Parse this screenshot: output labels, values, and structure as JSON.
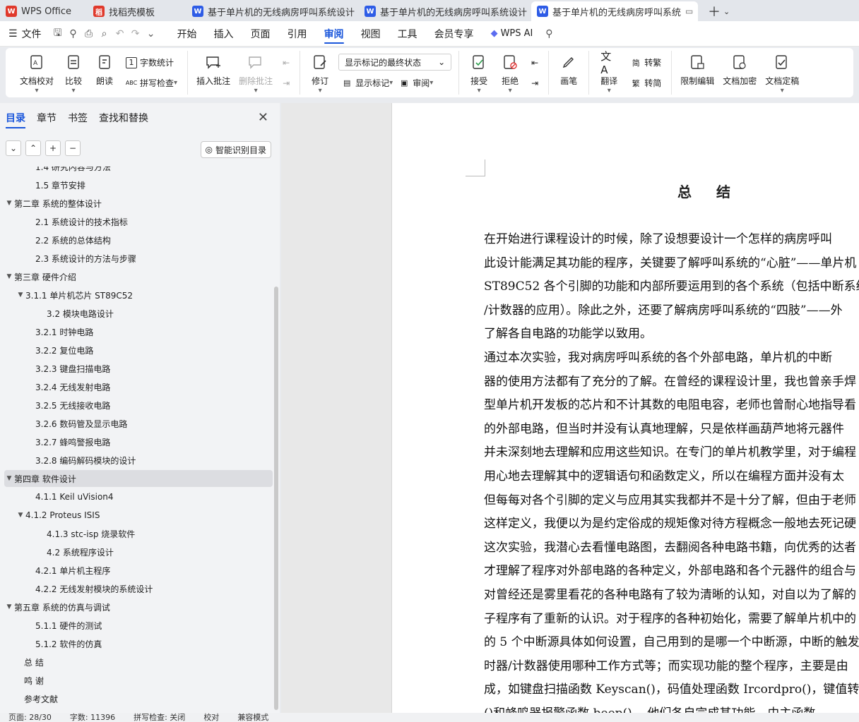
{
  "tabs": [
    {
      "label": "WPS Office",
      "icon": "wps-logo-icon",
      "color": "#e0392b"
    },
    {
      "label": "找稻壳模板",
      "icon": "docer-logo-icon",
      "color": "#e0392b"
    },
    {
      "label": "基于单片机的无线病房呼叫系统设计",
      "icon": "writer-doc-icon",
      "color": "#2e5ce6"
    },
    {
      "label": "基于单片机的无线病房呼叫系统设计",
      "icon": "writer-doc-icon",
      "color": "#2e5ce6"
    },
    {
      "label": "基于单片机的无线病房呼叫系统",
      "icon": "writer-doc-icon",
      "color": "#2e5ce6",
      "active": true
    }
  ],
  "menubar": {
    "file_label": "文件",
    "items": [
      "开始",
      "插入",
      "页面",
      "引用",
      "审阅",
      "视图",
      "工具",
      "会员专享"
    ],
    "active": "审阅",
    "ai_label": "WPS AI"
  },
  "ribbon": {
    "doc_proof": "文档校对",
    "compare": "比较",
    "read_aloud": "朗读",
    "word_count": "字数统计",
    "spell_check": "拼写检查",
    "insert_comment": "插入批注",
    "delete_comment": "删除批注",
    "track_changes": "修订",
    "markup_state": "显示标记的最终状态",
    "show_markup": "显示标记",
    "review": "审阅",
    "accept": "接受",
    "reject": "拒绝",
    "pen": "画笔",
    "translate": "翻译",
    "to_traditional": "转繁",
    "to_simplified": "转简",
    "restrict_edit": "限制编辑",
    "encrypt": "文档加密",
    "finalize": "文档定稿"
  },
  "leftpanel": {
    "tabs": [
      "目录",
      "章节",
      "书签",
      "查找和替换"
    ],
    "active_tab": "目录",
    "smart_toc": "智能识别目录",
    "toc": [
      {
        "text": "1.4  研究内容与方法",
        "level": 2,
        "partial": true
      },
      {
        "text": "1.5  章节安排",
        "level": 2
      },
      {
        "text": "第二章  系统的整体设计",
        "level": 1,
        "expanded": true
      },
      {
        "text": "2.1 系统设计的技术指标",
        "level": 2
      },
      {
        "text": "2.2 系统的总体结构",
        "level": 2
      },
      {
        "text": "2.3 系统设计的方法与步骤",
        "level": 2
      },
      {
        "text": "第三章  硬件介绍",
        "level": 1,
        "expanded": true
      },
      {
        "text": "3.1.1 单片机芯片 ST89C52",
        "level": 2,
        "expanded": true
      },
      {
        "text": "3.2 模块电路设计",
        "level": 3
      },
      {
        "text": "3.2.1  时钟电路",
        "level": 2
      },
      {
        "text": "3.2.2  复位电路",
        "level": 2
      },
      {
        "text": "3.2.3  键盘扫描电路",
        "level": 2
      },
      {
        "text": "3.2.4  无线发射电路",
        "level": 2
      },
      {
        "text": "3.2.5 无线接收电路",
        "level": 2
      },
      {
        "text": "3.2.6 数码管及显示电路",
        "level": 2
      },
      {
        "text": "3.2.7 蜂鸣警报电路",
        "level": 2
      },
      {
        "text": "3.2.8  编码解码模块的设计",
        "level": 2
      },
      {
        "text": "第四章    软件设计",
        "level": 1,
        "expanded": true,
        "selected": true
      },
      {
        "text": "4.1.1 Keil uVision4",
        "level": 2
      },
      {
        "text": "4.1.2 Proteus ISIS",
        "level": 2,
        "expanded": true
      },
      {
        "text": "4.1.3 stc-isp 烧录软件",
        "level": 3
      },
      {
        "text": "4.2   系统程序设计",
        "level": 3
      },
      {
        "text": "4.2.1 单片机主程序",
        "level": 2
      },
      {
        "text": "4.2.2 无线发射模块的系统设计",
        "level": 2
      },
      {
        "text": "第五章  系统的仿真与调试",
        "level": 1,
        "expanded": true
      },
      {
        "text": "5.1.1 硬件的测试",
        "level": 2
      },
      {
        "text": "5.1.2  软件的仿真",
        "level": 2
      },
      {
        "text": "总    结",
        "level": 1
      },
      {
        "text": "鸣    谢",
        "level": 1
      },
      {
        "text": "参考文献",
        "level": 1
      }
    ]
  },
  "document": {
    "title": "总  结",
    "lines": [
      "    在开始进行课程设计的时候，除了设想要设计一个怎样的病房呼叫",
      "此设计能满足其功能的程序，关键要了解呼叫系统的“心脏”——单片机",
      "ST89C52 各个引脚的功能和内部所要运用到的各个系统（包括中断系统",
      "/计数器的应用）。除此之外，还要了解病房呼叫系统的“四肢”——外",
      "了解各自电路的功能学以致用。",
      "    通过本次实验，我对病房呼叫系统的各个外部电路，单片机的中断",
      "器的使用方法都有了充分的了解。在曾经的课程设计里，我也曾亲手焊",
      "型单片机开发板的芯片和不计其数的电阻电容，老师也曾耐心地指导看",
      "的外部电路，但当时并没有认真地理解，只是依样画葫芦地将元器件",
      "并未深刻地去理解和应用这些知识。在专门的单片机教学里，对于编程",
      "用心地去理解其中的逻辑语句和函数定义，所以在编程方面并没有太",
      "但每每对各个引脚的定义与应用其实我都并不是十分了解，但由于老师",
      "这样定义，我便以为是约定俗成的规矩像对待方程概念一般地去死记硬",
      "这次实验，我潜心去看懂电路图，去翻阅各种电路书籍，向优秀的达者",
      "才理解了程序对外部电路的各种定义，外部电路和各个元器件的组合与",
      "对曾经还是雾里看花的各种电路有了较为清晰的认知，对自以为了解的",
      "子程序有了重新的认识。对于程序的各种初始化，需要了解单片机中的",
      "的 5 个中断源具体如何设置，自己用到的是哪一个中断源，中断的触发",
      "时器/计数器使用哪种工作方式等；而实现功能的整个程序，主要是由",
      "成，如键盘扫描函数 Keyscan()，码值处理函数 Ircordpro()，键值转化程",
      "()和蜂鸣器报警函数 beep()...  他们各自完成其功能，由主函数"
    ]
  },
  "status": {
    "page": "页面: 28/30",
    "words": "字数: 11396",
    "spell": "拼写检查: 关闭",
    "proof": "校对",
    "compat": "兼容模式"
  }
}
